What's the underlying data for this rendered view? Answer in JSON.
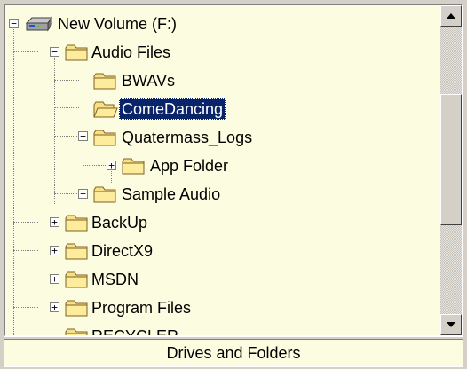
{
  "tree": {
    "nodes": [
      {
        "id": "drive",
        "label": "New Volume (F:)",
        "icon": "drive-icon",
        "expander": "−"
      },
      {
        "id": "audio",
        "label": "Audio Files",
        "icon": "folder-open-icon",
        "expander": "−"
      },
      {
        "id": "bwavs",
        "label": "BWAVs",
        "icon": "folder-icon"
      },
      {
        "id": "comedancing",
        "label": "ComeDancing",
        "icon": "folder-open-icon",
        "selected": true
      },
      {
        "id": "quatermass",
        "label": "Quatermass_Logs",
        "icon": "folder-open-icon",
        "expander": "−"
      },
      {
        "id": "appfolder",
        "label": "App Folder",
        "icon": "folder-icon",
        "expander": "+"
      },
      {
        "id": "sampleaudio",
        "label": "Sample Audio",
        "icon": "folder-icon",
        "expander": "+"
      },
      {
        "id": "backup",
        "label": "BackUp",
        "icon": "folder-icon",
        "expander": "+"
      },
      {
        "id": "directx9",
        "label": "DirectX9",
        "icon": "folder-icon",
        "expander": "+"
      },
      {
        "id": "msdn",
        "label": "MSDN",
        "icon": "folder-icon",
        "expander": "+"
      },
      {
        "id": "programfiles",
        "label": "Program Files",
        "icon": "folder-icon",
        "expander": "+"
      },
      {
        "id": "recycler",
        "label": "RECYCLER",
        "icon": "folder-icon"
      }
    ]
  },
  "scrollbar": {
    "up_icon": "arrow-up-icon",
    "down_icon": "arrow-down-icon"
  },
  "status": {
    "label": "Drives and Folders"
  },
  "colors": {
    "background": "#fcfce0",
    "selection": "#0a246a",
    "folder": "#f8e088"
  }
}
